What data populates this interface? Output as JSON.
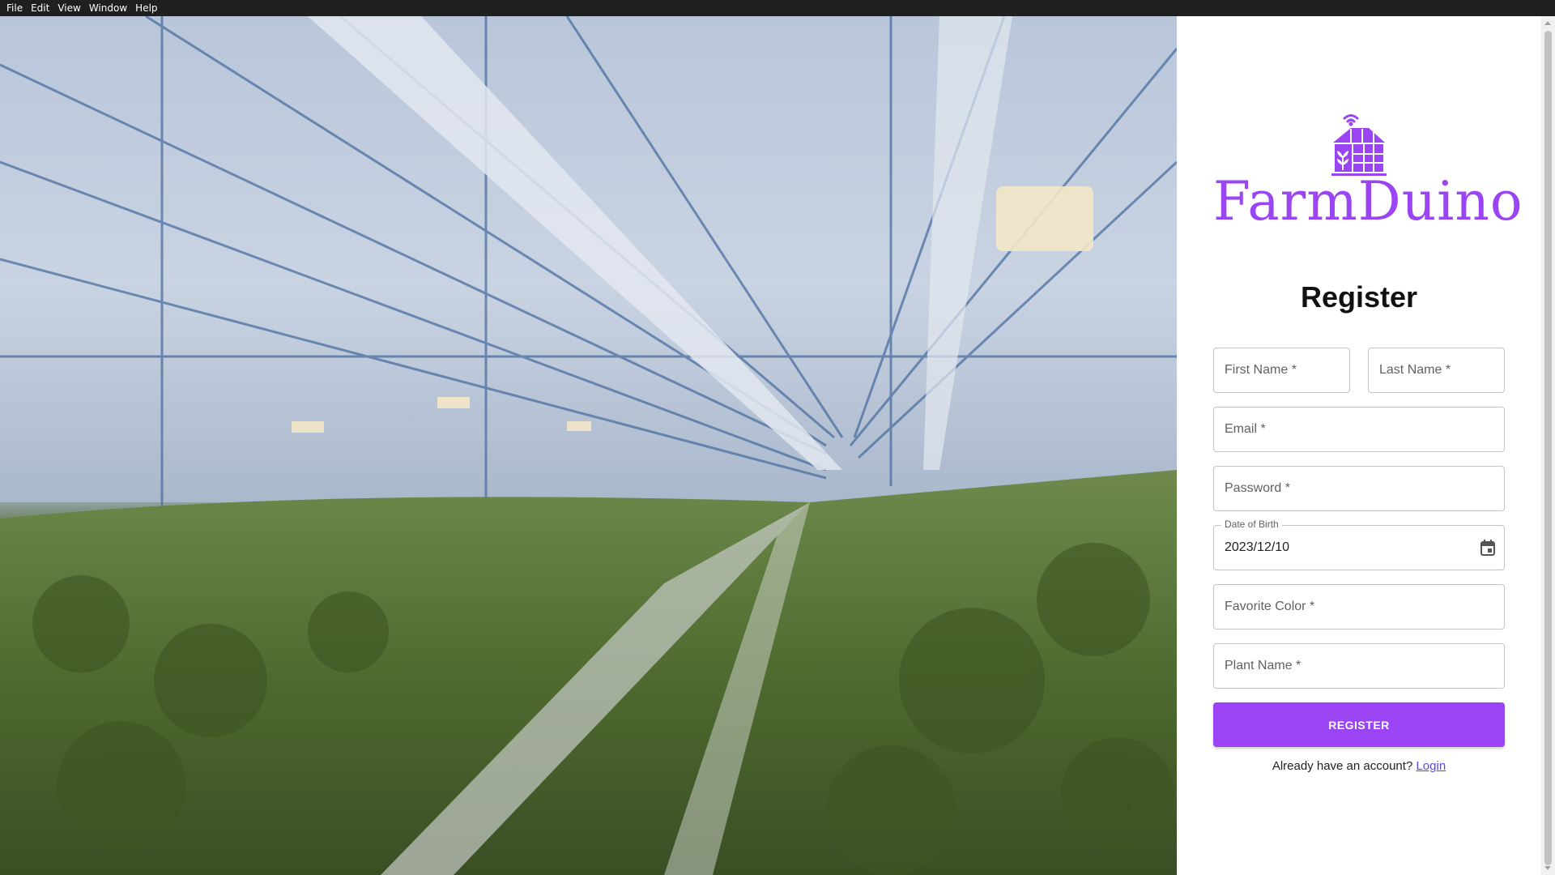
{
  "menu": {
    "items": [
      "File",
      "Edit",
      "View",
      "Window",
      "Help"
    ]
  },
  "brand": {
    "name": "FarmDuino",
    "color": "#9a44f4",
    "icon": "greenhouse-wifi-icon"
  },
  "form": {
    "title": "Register",
    "first_name": {
      "placeholder": "First Name",
      "required_mark": "*"
    },
    "last_name": {
      "placeholder": "Last Name",
      "required_mark": "*"
    },
    "email": {
      "placeholder": "Email",
      "required_mark": "*"
    },
    "password": {
      "placeholder": "Password",
      "required_mark": "*"
    },
    "date_of_birth": {
      "label": "Date of Birth",
      "value": "2023/12/10",
      "icon": "calendar-icon"
    },
    "favorite_color": {
      "placeholder": "Favorite Color",
      "required_mark": "*"
    },
    "plant_name": {
      "placeholder": "Plant Name",
      "required_mark": "*"
    },
    "submit_label": "REGISTER",
    "login_prompt": "Already have an account?",
    "login_link": "Login"
  },
  "colors": {
    "accent": "#9a44f4",
    "link": "#5b45e4"
  }
}
